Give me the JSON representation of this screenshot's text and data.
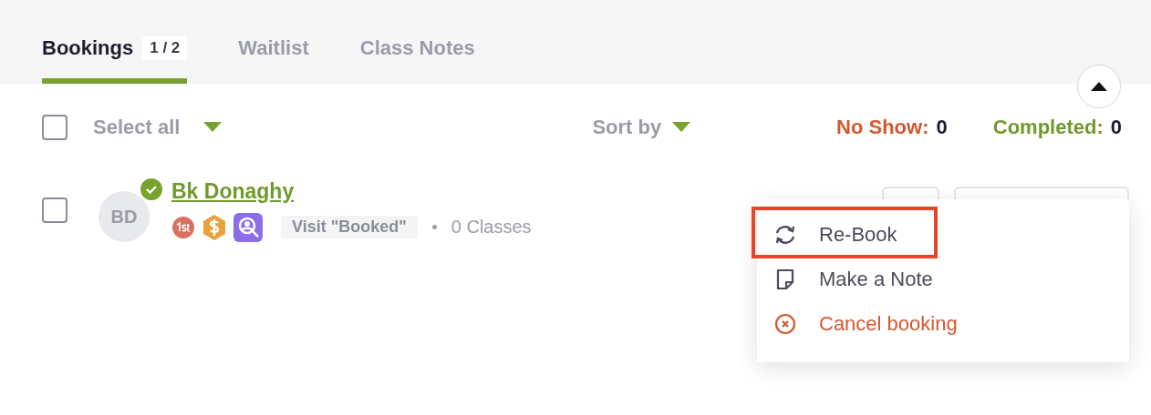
{
  "tabs": [
    {
      "label": "Bookings",
      "count": "1 / 2",
      "selected": true
    },
    {
      "label": "Waitlist",
      "selected": false
    },
    {
      "label": "Class Notes",
      "selected": false
    }
  ],
  "toolbar": {
    "select_all": {
      "label": "Select all",
      "checked": false
    },
    "sort": {
      "label": "Sort by"
    },
    "stats": [
      {
        "label": "No Show:",
        "value": "0",
        "color": "#d4572e"
      },
      {
        "label": "Completed:",
        "value": "0",
        "color": "#6f9a2c"
      }
    ]
  },
  "bookings": [
    {
      "checked": false,
      "initials": "BD",
      "verified": true,
      "name": "Bk Donaghy",
      "badges": [
        {
          "kind": "first"
        },
        {
          "kind": "dollar"
        },
        {
          "kind": "search"
        }
      ],
      "status": "Visit \"Booked\"",
      "classes": "0 Classes"
    }
  ],
  "menu": {
    "items": [
      {
        "kind": "rebook",
        "label": "Re-Book",
        "highlighted": true
      },
      {
        "kind": "note",
        "label": "Make a Note",
        "highlighted": false
      },
      {
        "kind": "cancel",
        "label": "Cancel booking",
        "highlighted": false
      }
    ]
  }
}
